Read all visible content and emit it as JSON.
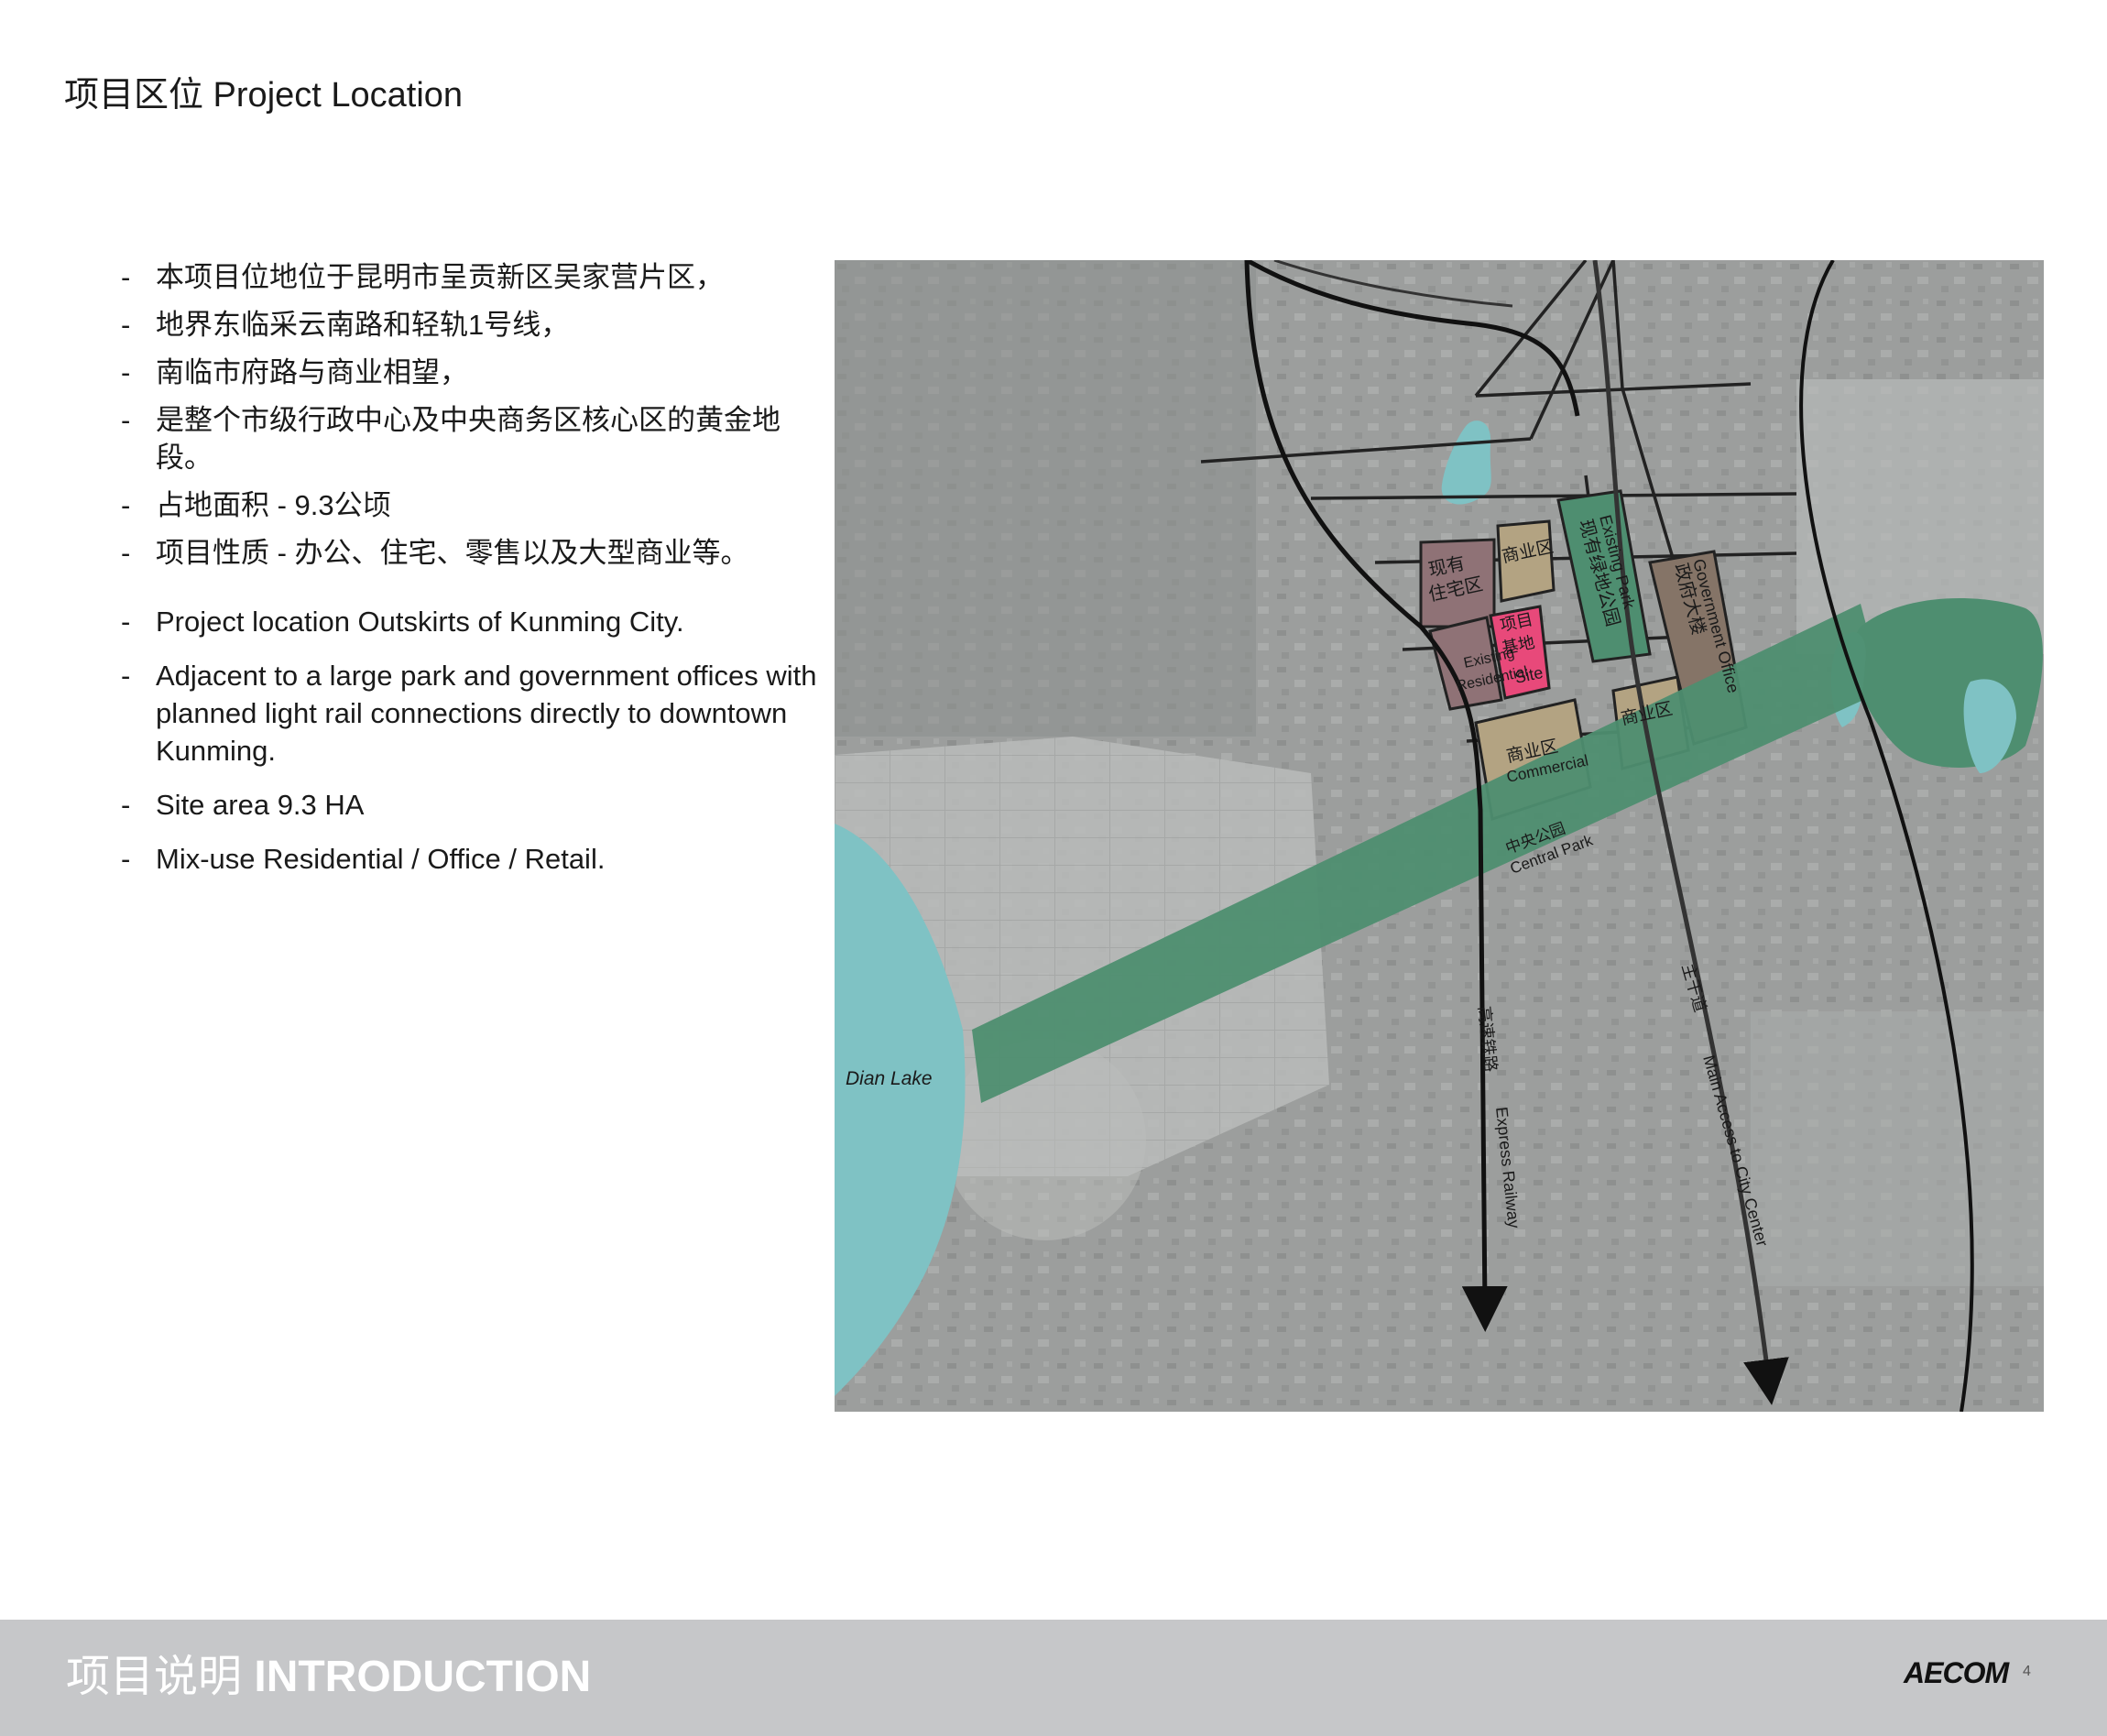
{
  "header": {
    "title": "项目区位 Project Location"
  },
  "bullets_cn": [
    "本项目位地位于昆明市呈贡新区吴家营片区，",
    "地界东临采云南路和轻轨1号线，",
    "南临市府路与商业相望，",
    "是整个市级行政中心及中央商务区核心区的黄金地段。",
    "占地面积 - 9.3公顷",
    "项目性质 - 办公、住宅、零售以及大型商业等。"
  ],
  "bullets_en": [
    "Project location Outskirts of Kunming City.",
    "Adjacent to a large park and government offices with planned light rail connections directly to downtown Kunming.",
    "Site area 9.3 HA",
    "Mix-use Residential / Office / Retail."
  ],
  "map": {
    "labels": {
      "existing_res_cn": [
        "现有",
        "住宅区"
      ],
      "commercial_cn_1": "商业区",
      "site_cn": [
        "项目",
        "基地"
      ],
      "site_en": "Site",
      "existing_res_en": [
        "Existing",
        "Residential"
      ],
      "existing_park_en": "Existing Park",
      "existing_park_cn": "现有绿地公园",
      "government_en": "Government Office",
      "government_cn": "政府大楼",
      "commercial_cn_2": "商业区",
      "commercial_cn_3": "商业区",
      "commercial_en": "Commercial",
      "central_park_cn": "中央公园",
      "central_park_en": "Central Park",
      "dian_lake": "Dian Lake",
      "express_railway_cn": "高速铁路",
      "express_railway_en": "Express Railway",
      "main_access_cn": "主干道",
      "main_access_en": "Main Access to City Center"
    },
    "colors": {
      "residential": "#8f7276",
      "commercial": "#b3a382",
      "site": "#e8497a",
      "park": "#4e8e70",
      "government": "#857467",
      "water": "#7fc2c4",
      "base": "#9fa1a0"
    }
  },
  "footer": {
    "title_cn": "项目说明",
    "title_en": "INTRODUCTION",
    "logo": "AECOM",
    "page_number": "4"
  }
}
